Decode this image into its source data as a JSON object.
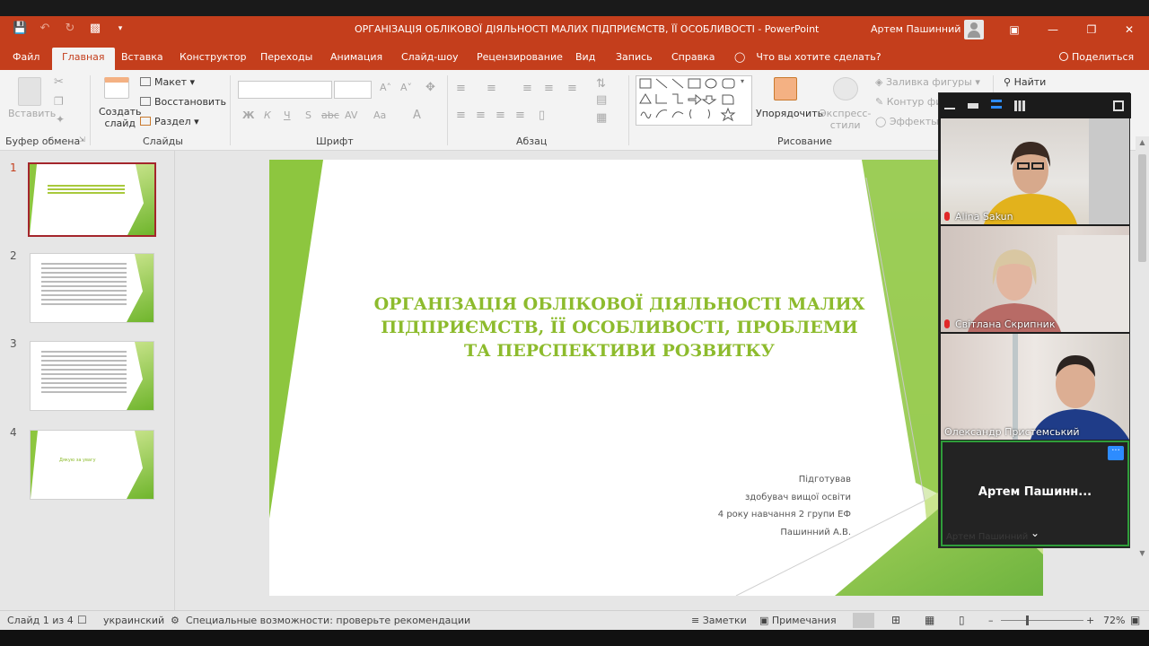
{
  "window": {
    "title": "ОРГАНІЗАЦІЯ ОБЛІКОВОЇ ДІЯЛЬНОСТІ МАЛИХ ПІДПРИЄМСТВ, ЇЇ ОСОБЛИВОСТІ  -  PowerPoint",
    "user": "Артем Пашинний"
  },
  "ribbon_tabs": [
    "Файл",
    "Главная",
    "Вставка",
    "Конструктор",
    "Переходы",
    "Анимация",
    "Слайд-шоу",
    "Рецензирование",
    "Вид",
    "Запись",
    "Справка"
  ],
  "tell_me": "Что вы хотите сделать?",
  "share": "Поделиться",
  "ribbon": {
    "paste": "Вставить",
    "clipboard_group": "Буфер обмена",
    "new_slide": "Создать\nслайд",
    "new_slide_l1": "Создать",
    "new_slide_l2": "слайд",
    "layout": "Макет",
    "reset": "Восстановить",
    "section": "Раздел",
    "slides_group": "Слайды",
    "font_group": "Шрифт",
    "paragraph_group": "Абзац",
    "arrange": "Упорядочить",
    "quick_styles_l1": "Экспресс-",
    "quick_styles_l2": "стили",
    "shape_fill": "Заливка фигуры",
    "shape_outline": "Контур фи",
    "shape_effects": "Эффекты",
    "drawing_group": "Рисование",
    "find": "Найти"
  },
  "thumbnails": {
    "numbers": [
      "1",
      "2",
      "3",
      "4"
    ],
    "slide4_text": "Дякую за увагу"
  },
  "slide": {
    "title_lines": [
      "ОРГАНІЗАЦІЯ ОБЛІКОВОЇ ДІЯЛЬНОСТІ МАЛИХ",
      "ПІДПРИЄМСТВ, ЇЇ ОСОБЛИВОСТІ, ПРОБЛЕМИ",
      "ТА ПЕРСПЕКТИВИ РОЗВИТКУ"
    ],
    "subtitle_lines": [
      "Підготував",
      "здобувач вищої освіти",
      "4 року навчання 2 групи ЕФ",
      "Пашинний А.В."
    ]
  },
  "zoom": {
    "participants": [
      {
        "name": "Alina Sakun",
        "muted": true
      },
      {
        "name": "Світлана Скрипник",
        "muted": true
      },
      {
        "name": "Олександр Пристемський",
        "muted": false
      }
    ],
    "self_name": "Артем  Пашинн...",
    "self_more": "···",
    "self_ghost": "Артем Пашинний"
  },
  "status": {
    "slide_of": "Слайд 1 из 4",
    "language": "украинский",
    "accessibility": "Специальные возможности: проверьте рекомендации",
    "notes": "Заметки",
    "comments": "Примечания",
    "zoom_level": "72%"
  },
  "colors": {
    "accent": "#c43e1c",
    "slide_green": "#8dbb2d"
  }
}
